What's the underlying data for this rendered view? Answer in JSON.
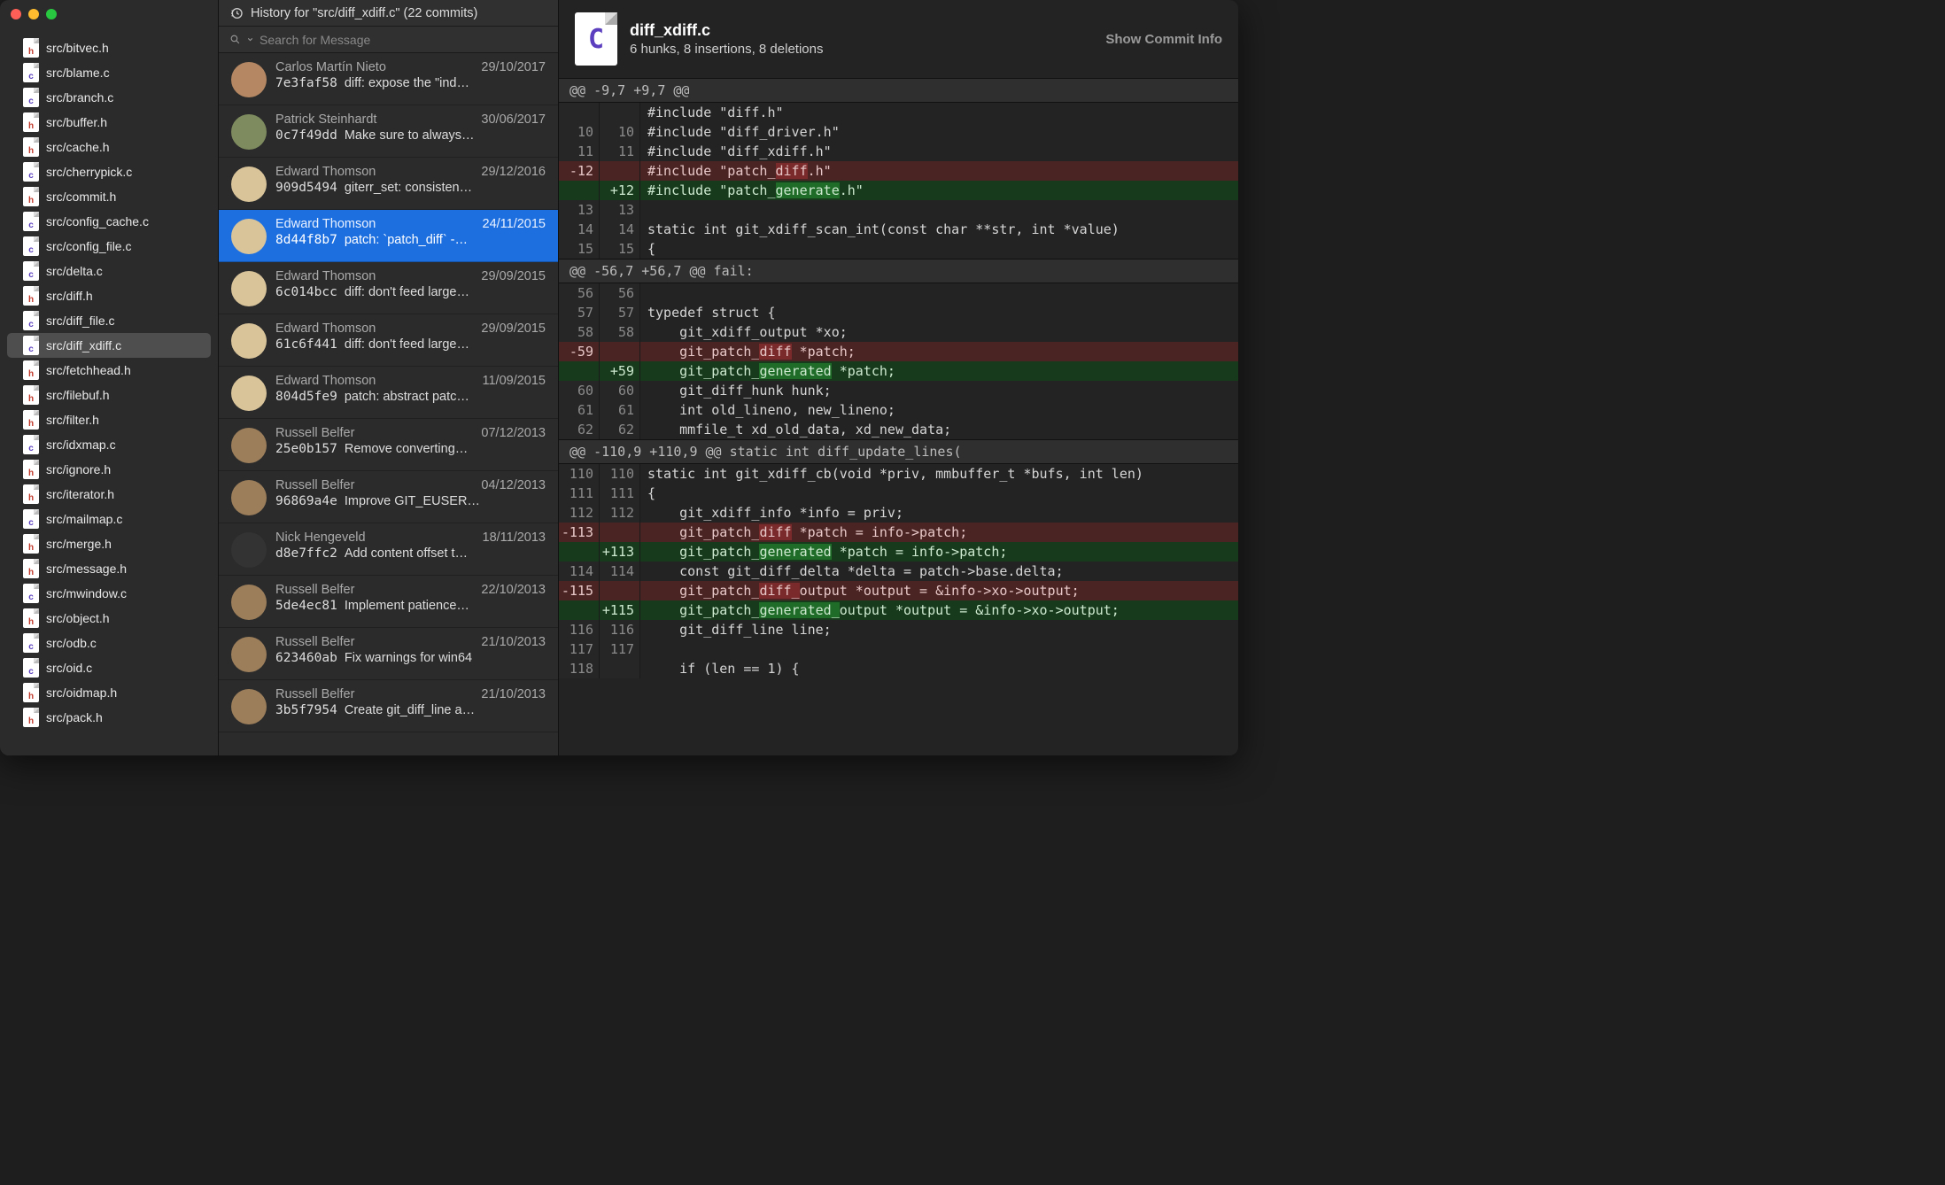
{
  "sidebar": {
    "files": [
      {
        "name": "src/bitvec.h",
        "kind": "h"
      },
      {
        "name": "src/blame.c",
        "kind": "c"
      },
      {
        "name": "src/branch.c",
        "kind": "c"
      },
      {
        "name": "src/buffer.h",
        "kind": "h"
      },
      {
        "name": "src/cache.h",
        "kind": "h"
      },
      {
        "name": "src/cherrypick.c",
        "kind": "c"
      },
      {
        "name": "src/commit.h",
        "kind": "h"
      },
      {
        "name": "src/config_cache.c",
        "kind": "c"
      },
      {
        "name": "src/config_file.c",
        "kind": "c"
      },
      {
        "name": "src/delta.c",
        "kind": "c"
      },
      {
        "name": "src/diff.h",
        "kind": "h"
      },
      {
        "name": "src/diff_file.c",
        "kind": "c"
      },
      {
        "name": "src/diff_xdiff.c",
        "kind": "c",
        "selected": true
      },
      {
        "name": "src/fetchhead.h",
        "kind": "h"
      },
      {
        "name": "src/filebuf.h",
        "kind": "h"
      },
      {
        "name": "src/filter.h",
        "kind": "h"
      },
      {
        "name": "src/idxmap.c",
        "kind": "c"
      },
      {
        "name": "src/ignore.h",
        "kind": "h"
      },
      {
        "name": "src/iterator.h",
        "kind": "h"
      },
      {
        "name": "src/mailmap.c",
        "kind": "c"
      },
      {
        "name": "src/merge.h",
        "kind": "h"
      },
      {
        "name": "src/message.h",
        "kind": "h"
      },
      {
        "name": "src/mwindow.c",
        "kind": "c"
      },
      {
        "name": "src/object.h",
        "kind": "h"
      },
      {
        "name": "src/odb.c",
        "kind": "c"
      },
      {
        "name": "src/oid.c",
        "kind": "c"
      },
      {
        "name": "src/oidmap.h",
        "kind": "h"
      },
      {
        "name": "src/pack.h",
        "kind": "h"
      }
    ]
  },
  "history": {
    "title": "History for \"src/diff_xdiff.c\" (22 commits)",
    "search_placeholder": "Search for Message",
    "commits": [
      {
        "author": "Carlos Martín Nieto",
        "date": "29/10/2017",
        "sha": "7e3faf58",
        "msg": "diff: expose the \"ind…",
        "av": "av-a"
      },
      {
        "author": "Patrick Steinhardt",
        "date": "30/06/2017",
        "sha": "0c7f49dd",
        "msg": "Make sure to always…",
        "av": "av-b"
      },
      {
        "author": "Edward Thomson",
        "date": "29/12/2016",
        "sha": "909d5494",
        "msg": "giterr_set: consisten…",
        "av": "av-c"
      },
      {
        "author": "Edward Thomson",
        "date": "24/11/2015",
        "sha": "8d44f8b7",
        "msg": "patch: `patch_diff` -…",
        "av": "av-c",
        "selected": true
      },
      {
        "author": "Edward Thomson",
        "date": "29/09/2015",
        "sha": "6c014bcc",
        "msg": "diff: don't feed large…",
        "av": "av-c"
      },
      {
        "author": "Edward Thomson",
        "date": "29/09/2015",
        "sha": "61c6f441",
        "msg": "diff: don't feed large…",
        "av": "av-c"
      },
      {
        "author": "Edward Thomson",
        "date": "11/09/2015",
        "sha": "804d5fe9",
        "msg": "patch: abstract patc…",
        "av": "av-c"
      },
      {
        "author": "Russell Belfer",
        "date": "07/12/2013",
        "sha": "25e0b157",
        "msg": "Remove converting…",
        "av": "av-e"
      },
      {
        "author": "Russell Belfer",
        "date": "04/12/2013",
        "sha": "96869a4e",
        "msg": "Improve GIT_EUSER…",
        "av": "av-e"
      },
      {
        "author": "Nick Hengeveld",
        "date": "18/11/2013",
        "sha": "d8e7ffc2",
        "msg": "Add content offset t…",
        "av": "av-d"
      },
      {
        "author": "Russell Belfer",
        "date": "22/10/2013",
        "sha": "5de4ec81",
        "msg": "Implement patience…",
        "av": "av-e"
      },
      {
        "author": "Russell Belfer",
        "date": "21/10/2013",
        "sha": "623460ab",
        "msg": "Fix warnings for win64",
        "av": "av-e"
      },
      {
        "author": "Russell Belfer",
        "date": "21/10/2013",
        "sha": "3b5f7954",
        "msg": "Create git_diff_line a…",
        "av": "av-e"
      }
    ]
  },
  "diff": {
    "filename": "diff_xdiff.c",
    "stats": "6 hunks, 8 insertions, 8 deletions",
    "show_info": "Show Commit Info",
    "hunks": [
      {
        "header": "@@ -9,7 +9,7 @@",
        "lines": [
          {
            "o": "",
            "n": "",
            "t": "plain",
            "text": "#include \"diff.h\""
          },
          {
            "o": "10",
            "n": "10",
            "t": "plain",
            "text": "#include \"diff_driver.h\""
          },
          {
            "o": "11",
            "n": "11",
            "t": "plain",
            "text": "#include \"diff_xdiff.h\""
          },
          {
            "o": "-12",
            "n": "",
            "t": "del",
            "pre": "#include \"patch_",
            "hl": "diff",
            "post": ".h\""
          },
          {
            "o": "",
            "n": "+12",
            "t": "add",
            "pre": "#include \"patch_",
            "hl": "generate",
            "post": ".h\""
          },
          {
            "o": "13",
            "n": "13",
            "t": "plain",
            "text": ""
          },
          {
            "o": "14",
            "n": "14",
            "t": "plain",
            "text": "static int git_xdiff_scan_int(const char **str, int *value)"
          },
          {
            "o": "15",
            "n": "15",
            "t": "plain",
            "text": "{"
          }
        ]
      },
      {
        "header": "@@ -56,7 +56,7 @@ fail:",
        "lines": [
          {
            "o": "56",
            "n": "56",
            "t": "plain",
            "text": ""
          },
          {
            "o": "57",
            "n": "57",
            "t": "plain",
            "text": "typedef struct {"
          },
          {
            "o": "58",
            "n": "58",
            "t": "plain",
            "text": "    git_xdiff_output *xo;"
          },
          {
            "o": "-59",
            "n": "",
            "t": "del",
            "pre": "    git_patch_",
            "hl": "diff",
            "post": " *patch;"
          },
          {
            "o": "",
            "n": "+59",
            "t": "add",
            "pre": "    git_patch_",
            "hl": "generated",
            "post": " *patch;"
          },
          {
            "o": "60",
            "n": "60",
            "t": "plain",
            "text": "    git_diff_hunk hunk;"
          },
          {
            "o": "61",
            "n": "61",
            "t": "plain",
            "text": "    int old_lineno, new_lineno;"
          },
          {
            "o": "62",
            "n": "62",
            "t": "plain",
            "text": "    mmfile_t xd_old_data, xd_new_data;"
          }
        ]
      },
      {
        "header": "@@ -110,9 +110,9 @@ static int diff_update_lines(",
        "lines": [
          {
            "o": "110",
            "n": "110",
            "t": "plain",
            "text": "static int git_xdiff_cb(void *priv, mmbuffer_t *bufs, int len)"
          },
          {
            "o": "111",
            "n": "111",
            "t": "plain",
            "text": "{"
          },
          {
            "o": "112",
            "n": "112",
            "t": "plain",
            "text": "    git_xdiff_info *info = priv;"
          },
          {
            "o": "-113",
            "n": "",
            "t": "del",
            "pre": "    git_patch_",
            "hl": "diff",
            "post": " *patch = info->patch;"
          },
          {
            "o": "",
            "n": "+113",
            "t": "add",
            "pre": "    git_patch_",
            "hl": "generated",
            "post": " *patch = info->patch;"
          },
          {
            "o": "114",
            "n": "114",
            "t": "plain",
            "text": "    const git_diff_delta *delta = patch->base.delta;"
          },
          {
            "o": "-115",
            "n": "",
            "t": "del",
            "pre": "    git_patch_",
            "hl": "diff_",
            "post": "output *output = &info->xo->output;"
          },
          {
            "o": "",
            "n": "+115",
            "t": "add",
            "pre": "    git_patch_",
            "hl": "generated_",
            "post": "output *output = &info->xo->output;"
          },
          {
            "o": "116",
            "n": "116",
            "t": "plain",
            "text": "    git_diff_line line;"
          },
          {
            "o": "117",
            "n": "117",
            "t": "plain",
            "text": ""
          },
          {
            "o": "118",
            "n": "",
            "t": "plain",
            "text": "    if (len == 1) {"
          }
        ]
      }
    ]
  }
}
